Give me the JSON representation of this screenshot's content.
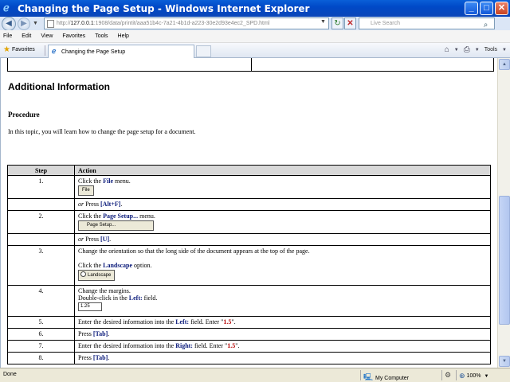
{
  "window": {
    "title": "Changing the Page Setup - Windows Internet Explorer",
    "icon": "ie-icon"
  },
  "address": {
    "url_prefix": "http://",
    "url_host": "127.0.0.1",
    "url_rest": ":1908/data/printit/aaa51b4c-7a21-4b1d-a223-30e2d93e4ec2_SPD.html",
    "search_placeholder": "Live Search"
  },
  "menu": [
    "File",
    "Edit",
    "View",
    "Favorites",
    "Tools",
    "Help"
  ],
  "favorites": {
    "label": "Favorites",
    "tab_title": "Changing the Page Setup",
    "tools_label": "Tools"
  },
  "content": {
    "heading": "Additional Information",
    "procedure_label": "Procedure",
    "intro": "In this topic, you will learn how to change the page setup for a document.",
    "table": {
      "col_step": "Step",
      "col_action": "Action",
      "rows": [
        {
          "step": "1.",
          "pre": "Click the ",
          "kw": "File",
          "post": " menu.",
          "button": "File"
        },
        {
          "step": "",
          "or": "or",
          "pre": " Press ",
          "kw": "[Alt+F]",
          "post": "."
        },
        {
          "step": "2.",
          "pre": "Click the ",
          "kw": "Page Setup...",
          "post": " menu.",
          "button": "Page Setup..."
        },
        {
          "step": "",
          "or": "or",
          "pre": " Press ",
          "kw": "[U]",
          "post": "."
        },
        {
          "step": "3.",
          "line1": "Change the orientation so that the long side of the document appears at the top of the page.",
          "pre": "Click the ",
          "kw": "Landscape",
          "post": " option.",
          "button": "Landscape"
        },
        {
          "step": "4.",
          "line1": "Change the margins.",
          "pre": "Double-click in the ",
          "kw": "Left:",
          "post": " field.",
          "field": "1.25"
        },
        {
          "step": "5.",
          "pre": "Enter the desired information into the ",
          "kw": "Left:",
          "mid": " field. Enter \"",
          "val": "1.5",
          "post": "\"."
        },
        {
          "step": "6.",
          "pre": "Press ",
          "kw": "[Tab]",
          "post": "."
        },
        {
          "step": "7.",
          "pre": "Enter the desired information into the ",
          "kw": "Right:",
          "mid": " field. Enter \"",
          "val": "1.5",
          "post": "\"."
        },
        {
          "step": "8.",
          "pre": "Press ",
          "kw": "[Tab]",
          "post": "."
        }
      ]
    }
  },
  "status": {
    "text": "Done",
    "zone": "My Computer",
    "zoom": "100%"
  },
  "colors": {
    "keyword": "#0a1a7a",
    "value": "#b40000",
    "titlebar": "#0a5fd8"
  }
}
